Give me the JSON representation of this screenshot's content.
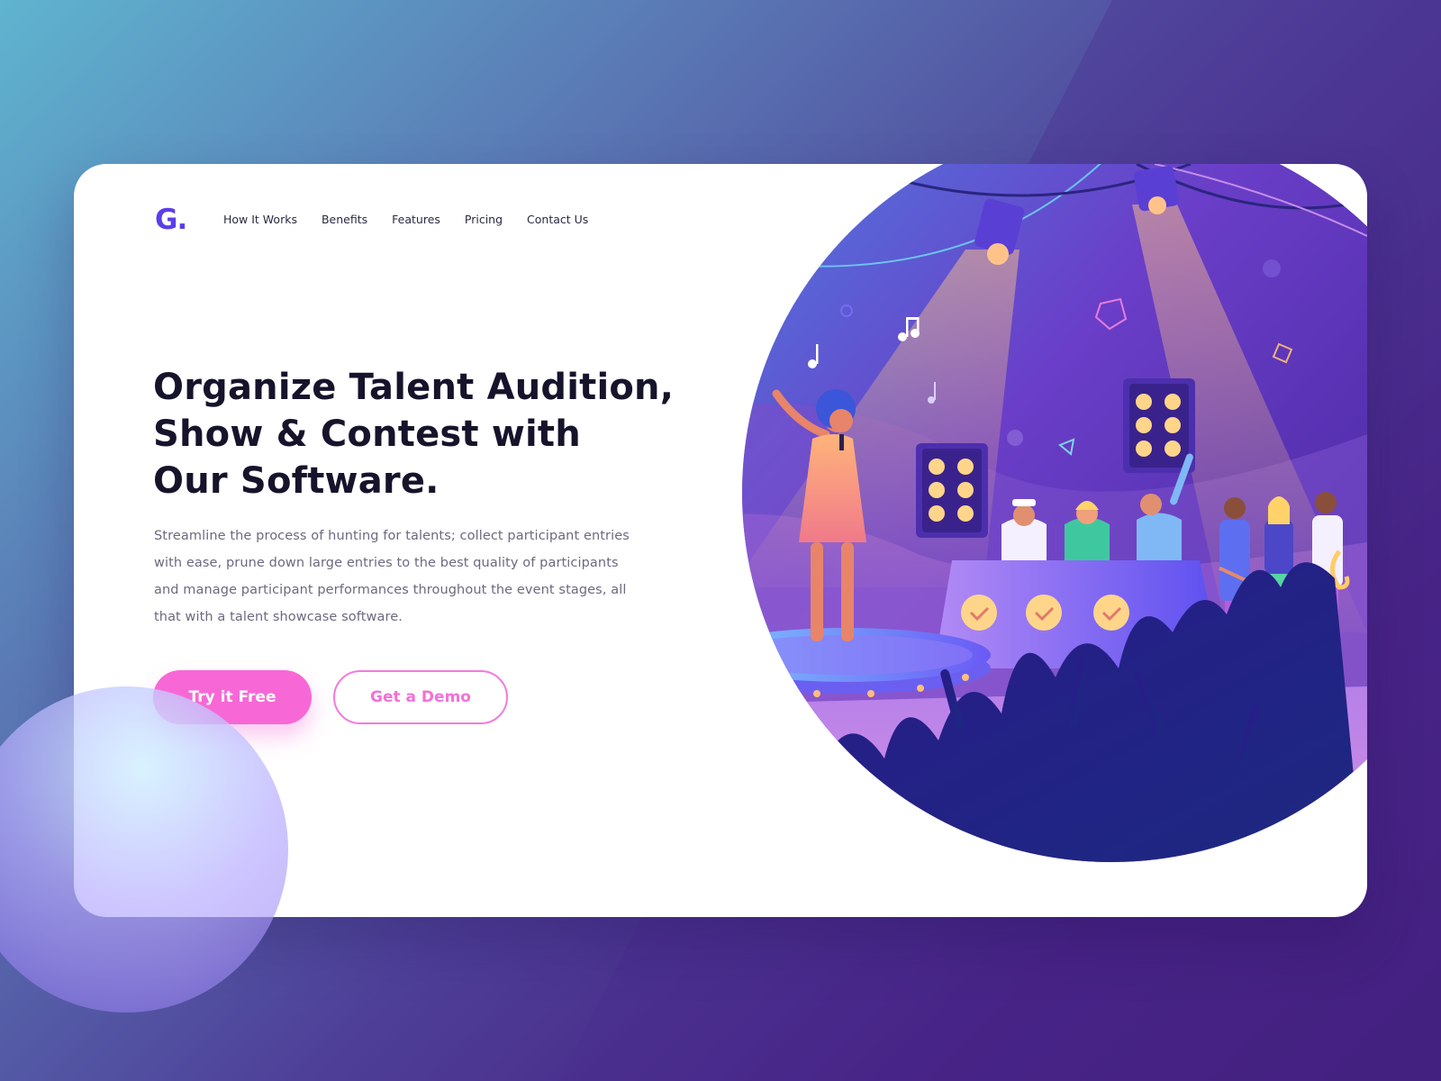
{
  "brand": {
    "logo_text": "G",
    "logo_dot": ".",
    "accent": "#5b3ee8"
  },
  "nav": {
    "items": [
      {
        "label": "How It Works"
      },
      {
        "label": "Benefits"
      },
      {
        "label": "Features"
      },
      {
        "label": "Pricing"
      },
      {
        "label": "Contact Us"
      }
    ]
  },
  "hero": {
    "headline_lines": [
      "Organize Talent Audition,",
      "Show & Contest with",
      "Our Software."
    ],
    "description": "Streamline the process of hunting for talents; collect participant entries with ease, prune down large entries to the best quality of participants and manage participant performances throughout the event stages, all that with a talent showcase software.",
    "primary_cta": "Try it Free",
    "secondary_cta": "Get a Demo",
    "cta_color": "#f768d6"
  },
  "illustration": {
    "subject": "talent show stage with singer, judges table, contestants and cheering crowd under spotlights",
    "icons": [
      "spotlight-icon",
      "music-note-icon",
      "check-badge-icon",
      "microphone-icon",
      "guitar-icon",
      "saxophone-icon"
    ]
  }
}
